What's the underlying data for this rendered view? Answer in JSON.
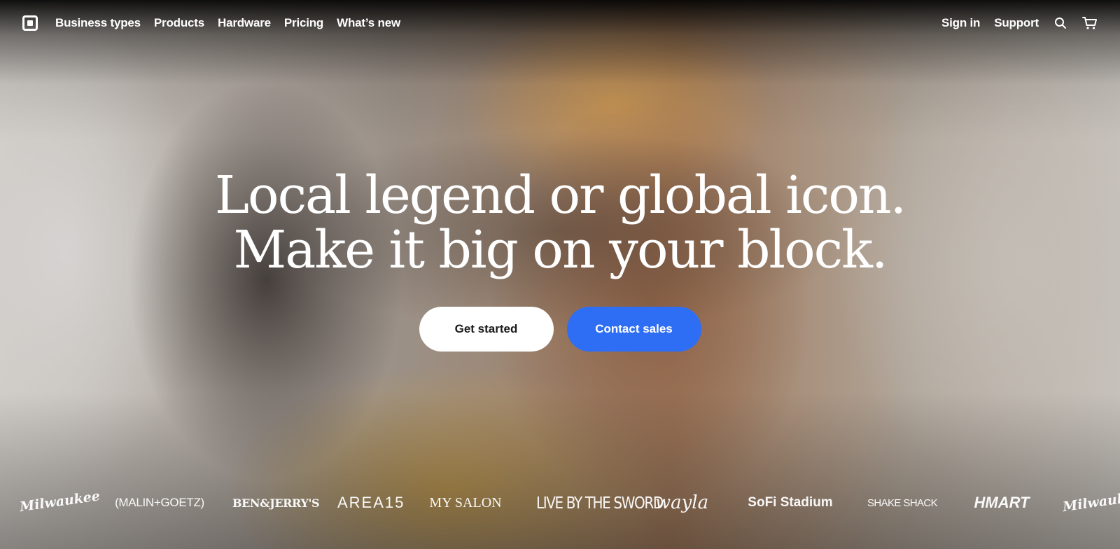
{
  "nav": {
    "logo_icon": "square-logo-icon",
    "left_links": [
      "Business types",
      "Products",
      "Hardware",
      "Pricing",
      "What’s new"
    ],
    "sign_in": "Sign in",
    "support": "Support",
    "search_icon": "search-icon",
    "cart_icon": "cart-icon"
  },
  "hero": {
    "headline_line1": "Local legend or global icon.",
    "headline_line2": "Make it big on your block.",
    "primary_cta": "Get started",
    "secondary_cta": "Contact sales"
  },
  "brands": [
    "Milwaukee",
    "(MALIN+GOETZ)",
    "BEN&JERRY'S",
    "AREA15",
    "MY SALON",
    "LIVE BY THE SWORD",
    "wayla",
    "SoFi Stadium",
    "SHAKE SHACK",
    "HMART",
    "Milwaukee"
  ],
  "colors": {
    "accent_blue": "#2e6ef5",
    "text_white": "#ffffff"
  }
}
